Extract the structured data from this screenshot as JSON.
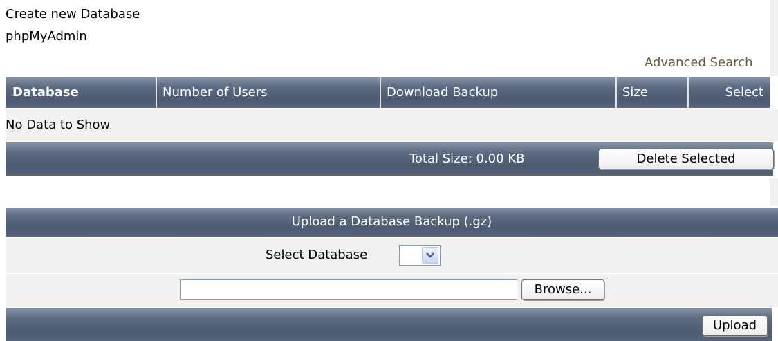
{
  "links": {
    "create_db": "Create new Database",
    "phpmyadmin": "phpMyAdmin",
    "advanced_search": "Advanced Search"
  },
  "db_table": {
    "columns": [
      "Database",
      "Number of Users",
      "Download Backup",
      "Size",
      "Select"
    ],
    "empty_text": "No Data to Show",
    "total_size": "Total Size: 0.00 KB",
    "delete_button": "Delete Selected"
  },
  "upload": {
    "title": "Upload a Database Backup (.gz)",
    "select_label": "Select Database",
    "select_value": "",
    "file_value": "",
    "browse_button": "Browse...",
    "upload_button": "Upload"
  },
  "colors": {
    "header_bg": "#56637a",
    "row_bg": "#f1f1ef",
    "link_color": "#6a5a40"
  }
}
